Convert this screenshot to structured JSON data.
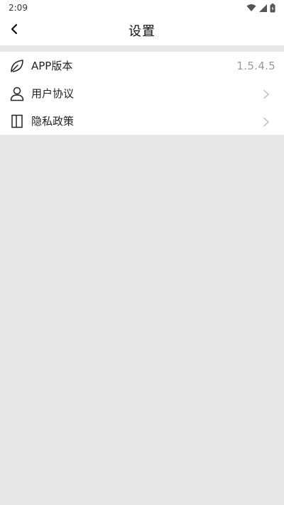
{
  "status_bar": {
    "time": "2:09",
    "icons": [
      "wifi-icon",
      "signal-icon",
      "battery-icon"
    ]
  },
  "app_bar": {
    "title": "设置",
    "back_icon": "chevron-left-icon"
  },
  "settings": {
    "items": [
      {
        "label": "APP版本",
        "value": "1.5.4.5",
        "icon": "leaf-icon"
      },
      {
        "label": "用户协议",
        "icon": "user-icon",
        "trailing": "chevron-right-icon"
      },
      {
        "label": "隐私政策",
        "icon": "book-icon",
        "trailing": "chevron-right-icon"
      }
    ]
  },
  "colors": {
    "background": "#e8e8e8",
    "surface": "#ffffff",
    "text_primary": "#222222",
    "text_secondary": "#9a9a9a"
  }
}
